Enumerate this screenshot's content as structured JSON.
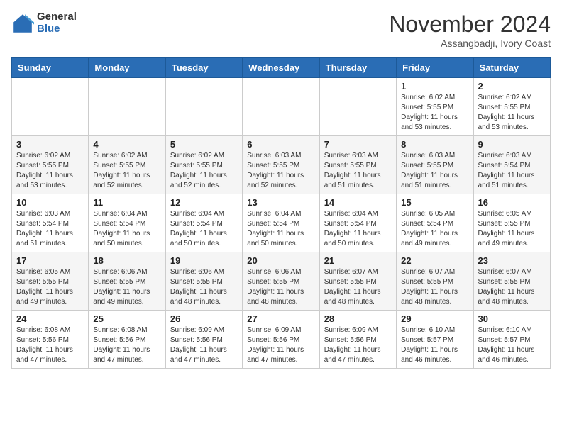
{
  "header": {
    "logo_general": "General",
    "logo_blue": "Blue",
    "month_title": "November 2024",
    "location": "Assangbadji, Ivory Coast"
  },
  "weekdays": [
    "Sunday",
    "Monday",
    "Tuesday",
    "Wednesday",
    "Thursday",
    "Friday",
    "Saturday"
  ],
  "weeks": [
    [
      {
        "day": "",
        "info": ""
      },
      {
        "day": "",
        "info": ""
      },
      {
        "day": "",
        "info": ""
      },
      {
        "day": "",
        "info": ""
      },
      {
        "day": "",
        "info": ""
      },
      {
        "day": "1",
        "info": "Sunrise: 6:02 AM\nSunset: 5:55 PM\nDaylight: 11 hours\nand 53 minutes."
      },
      {
        "day": "2",
        "info": "Sunrise: 6:02 AM\nSunset: 5:55 PM\nDaylight: 11 hours\nand 53 minutes."
      }
    ],
    [
      {
        "day": "3",
        "info": "Sunrise: 6:02 AM\nSunset: 5:55 PM\nDaylight: 11 hours\nand 53 minutes."
      },
      {
        "day": "4",
        "info": "Sunrise: 6:02 AM\nSunset: 5:55 PM\nDaylight: 11 hours\nand 52 minutes."
      },
      {
        "day": "5",
        "info": "Sunrise: 6:02 AM\nSunset: 5:55 PM\nDaylight: 11 hours\nand 52 minutes."
      },
      {
        "day": "6",
        "info": "Sunrise: 6:03 AM\nSunset: 5:55 PM\nDaylight: 11 hours\nand 52 minutes."
      },
      {
        "day": "7",
        "info": "Sunrise: 6:03 AM\nSunset: 5:55 PM\nDaylight: 11 hours\nand 51 minutes."
      },
      {
        "day": "8",
        "info": "Sunrise: 6:03 AM\nSunset: 5:55 PM\nDaylight: 11 hours\nand 51 minutes."
      },
      {
        "day": "9",
        "info": "Sunrise: 6:03 AM\nSunset: 5:54 PM\nDaylight: 11 hours\nand 51 minutes."
      }
    ],
    [
      {
        "day": "10",
        "info": "Sunrise: 6:03 AM\nSunset: 5:54 PM\nDaylight: 11 hours\nand 51 minutes."
      },
      {
        "day": "11",
        "info": "Sunrise: 6:04 AM\nSunset: 5:54 PM\nDaylight: 11 hours\nand 50 minutes."
      },
      {
        "day": "12",
        "info": "Sunrise: 6:04 AM\nSunset: 5:54 PM\nDaylight: 11 hours\nand 50 minutes."
      },
      {
        "day": "13",
        "info": "Sunrise: 6:04 AM\nSunset: 5:54 PM\nDaylight: 11 hours\nand 50 minutes."
      },
      {
        "day": "14",
        "info": "Sunrise: 6:04 AM\nSunset: 5:54 PM\nDaylight: 11 hours\nand 50 minutes."
      },
      {
        "day": "15",
        "info": "Sunrise: 6:05 AM\nSunset: 5:54 PM\nDaylight: 11 hours\nand 49 minutes."
      },
      {
        "day": "16",
        "info": "Sunrise: 6:05 AM\nSunset: 5:55 PM\nDaylight: 11 hours\nand 49 minutes."
      }
    ],
    [
      {
        "day": "17",
        "info": "Sunrise: 6:05 AM\nSunset: 5:55 PM\nDaylight: 11 hours\nand 49 minutes."
      },
      {
        "day": "18",
        "info": "Sunrise: 6:06 AM\nSunset: 5:55 PM\nDaylight: 11 hours\nand 49 minutes."
      },
      {
        "day": "19",
        "info": "Sunrise: 6:06 AM\nSunset: 5:55 PM\nDaylight: 11 hours\nand 48 minutes."
      },
      {
        "day": "20",
        "info": "Sunrise: 6:06 AM\nSunset: 5:55 PM\nDaylight: 11 hours\nand 48 minutes."
      },
      {
        "day": "21",
        "info": "Sunrise: 6:07 AM\nSunset: 5:55 PM\nDaylight: 11 hours\nand 48 minutes."
      },
      {
        "day": "22",
        "info": "Sunrise: 6:07 AM\nSunset: 5:55 PM\nDaylight: 11 hours\nand 48 minutes."
      },
      {
        "day": "23",
        "info": "Sunrise: 6:07 AM\nSunset: 5:55 PM\nDaylight: 11 hours\nand 48 minutes."
      }
    ],
    [
      {
        "day": "24",
        "info": "Sunrise: 6:08 AM\nSunset: 5:56 PM\nDaylight: 11 hours\nand 47 minutes."
      },
      {
        "day": "25",
        "info": "Sunrise: 6:08 AM\nSunset: 5:56 PM\nDaylight: 11 hours\nand 47 minutes."
      },
      {
        "day": "26",
        "info": "Sunrise: 6:09 AM\nSunset: 5:56 PM\nDaylight: 11 hours\nand 47 minutes."
      },
      {
        "day": "27",
        "info": "Sunrise: 6:09 AM\nSunset: 5:56 PM\nDaylight: 11 hours\nand 47 minutes."
      },
      {
        "day": "28",
        "info": "Sunrise: 6:09 AM\nSunset: 5:56 PM\nDaylight: 11 hours\nand 47 minutes."
      },
      {
        "day": "29",
        "info": "Sunrise: 6:10 AM\nSunset: 5:57 PM\nDaylight: 11 hours\nand 46 minutes."
      },
      {
        "day": "30",
        "info": "Sunrise: 6:10 AM\nSunset: 5:57 PM\nDaylight: 11 hours\nand 46 minutes."
      }
    ]
  ]
}
